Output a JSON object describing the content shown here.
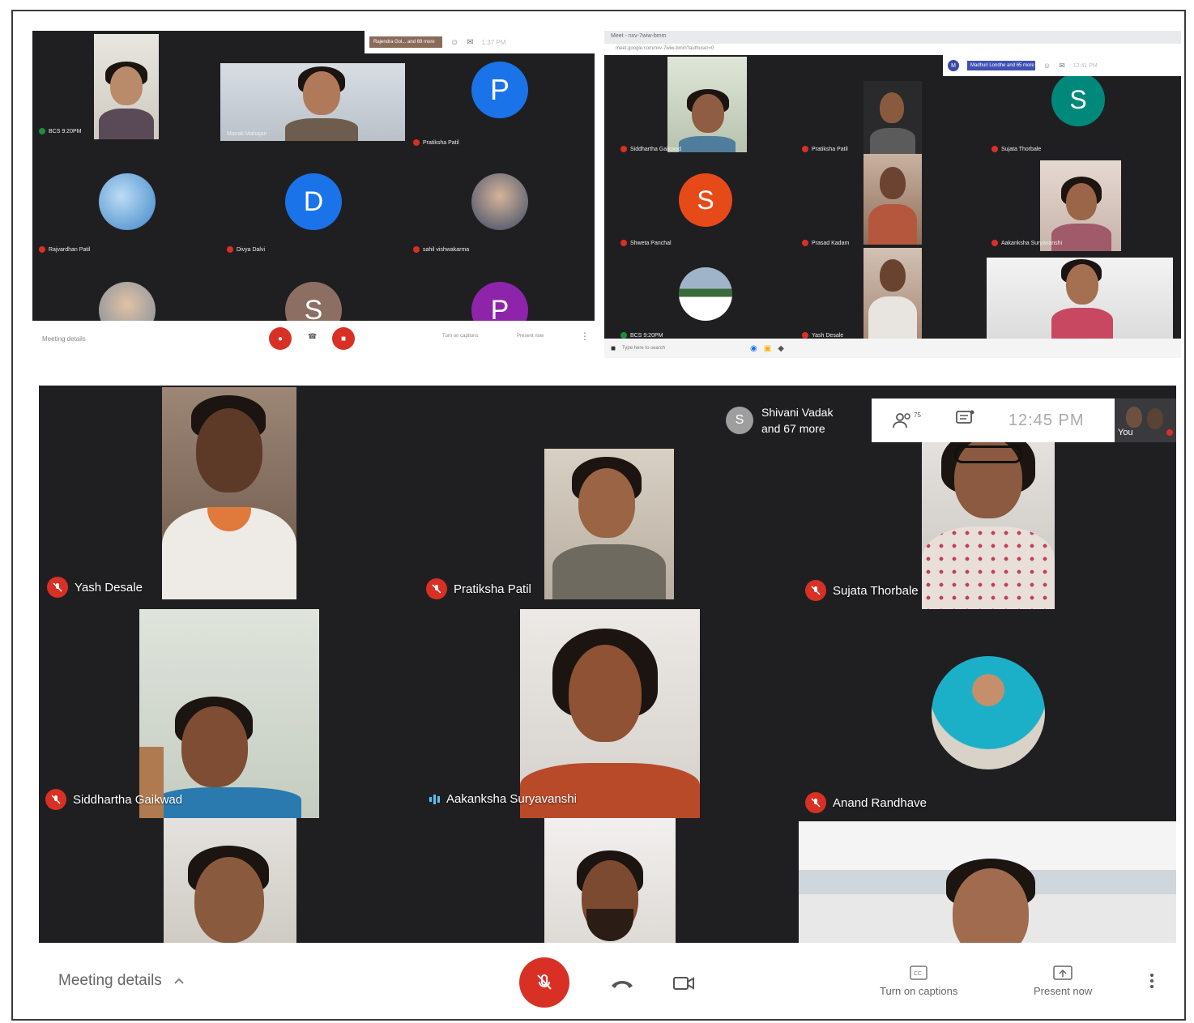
{
  "top_left": {
    "participants": [
      {
        "name": "BCS 9:20PM",
        "type": "video"
      },
      {
        "name": "Manali Mahajan",
        "type": "video"
      },
      {
        "name": "Pratiksha Patil",
        "type": "avatar",
        "initial": "P",
        "color": "#1a73e8"
      },
      {
        "name": "Rajvardhan Patil",
        "type": "photo"
      },
      {
        "name": "Divya Dalvi",
        "type": "avatar",
        "initial": "D",
        "color": "#1a73e8"
      },
      {
        "name": "sahil vishwakarma",
        "type": "photo"
      },
      {
        "name": "",
        "type": "photo"
      },
      {
        "name": "",
        "type": "avatar",
        "initial": "S",
        "color": "#8d6e63"
      },
      {
        "name": "",
        "type": "avatar",
        "initial": "P",
        "color": "#8e24aa"
      }
    ],
    "topbar": {
      "presenter": "Rajendra Gol... and 69 more",
      "time": "1:37 PM"
    },
    "bottombar": {
      "meeting_details": "Meeting details",
      "captions": "Turn on captions",
      "present": "Present now"
    }
  },
  "top_right": {
    "browser_title": "Meet - nxv-7wiw-bmm",
    "url": "meet.google.com/nxv-7wiw-bmm?authuser=0",
    "participants": [
      {
        "name": "Siddhartha Gaikwad",
        "type": "video"
      },
      {
        "name": "Pratiksha Patil",
        "type": "video"
      },
      {
        "name": "Sujata Thorbale",
        "type": "avatar",
        "initial": "S",
        "color": "#00897b"
      },
      {
        "name": "Shweta Panchal",
        "type": "avatar",
        "initial": "S",
        "color": "#e64a19"
      },
      {
        "name": "Prasad Kadam",
        "type": "video"
      },
      {
        "name": "Aakanksha Suryavanshi",
        "type": "video"
      },
      {
        "name": "BCS 9:20PM",
        "type": "photo"
      },
      {
        "name": "Yash Desale",
        "type": "video"
      }
    ],
    "topbar": {
      "presenter": "Madhuri Londhe and 65 more",
      "time": "12:41 PM"
    },
    "taskbar": {
      "search": "Type here to search"
    }
  },
  "bottom": {
    "topbar": {
      "presenter_initial": "S",
      "presenter_line1": "Shivani Vadak",
      "presenter_line2": "and 67 more",
      "participant_count": "75",
      "time": "12:45 PM",
      "self_label": "You"
    },
    "participants": [
      {
        "name": "Yash Desale",
        "mic": "off"
      },
      {
        "name": "Pratiksha Patil",
        "mic": "off"
      },
      {
        "name": "Sujata Thorbale",
        "mic": "off"
      },
      {
        "name": "Siddhartha Gaikwad",
        "mic": "off"
      },
      {
        "name": "Aakanksha Suryavanshi",
        "mic": "speaking"
      },
      {
        "name": "Anand Randhave",
        "mic": "off"
      }
    ],
    "bottombar": {
      "meeting_details": "Meeting details",
      "captions": "Turn on captions",
      "present": "Present now"
    }
  },
  "colors": {
    "panel_bg": "#202124",
    "mic_off": "#d93025",
    "white": "#ffffff"
  },
  "icons": [
    "mic-off-icon",
    "hangup-icon",
    "camera-icon",
    "captions-icon",
    "present-icon",
    "more-vert-icon",
    "people-icon",
    "chat-icon",
    "chevron-up-icon"
  ]
}
